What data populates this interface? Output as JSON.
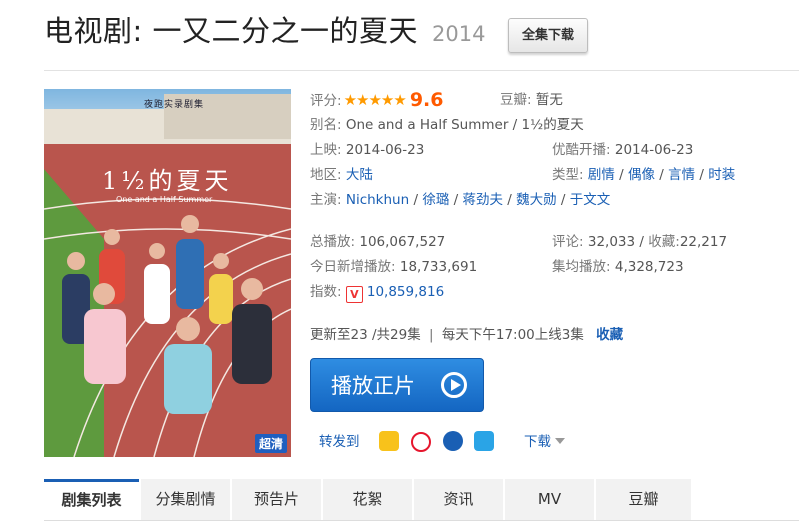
{
  "header": {
    "title": "电视剧: 一又二分之一的夏天",
    "year": "2014",
    "download_all_label": "全集下载"
  },
  "poster": {
    "tagline": "夜跑实录剧集",
    "title_text": "1½的夏天",
    "subtitle_text": "One and a Half Summer",
    "hd_badge": "超清"
  },
  "info": {
    "rating_label": "评分:",
    "rating_stars": "★★★★★",
    "rating_value": "9.6",
    "douban_label": "豆瓣:",
    "douban_value": "暂无",
    "alias_label": "别名:",
    "alias_value": "One and a Half Summer / 1½的夏天",
    "release_label": "上映:",
    "release_value": "2014-06-23",
    "youku_label": "优酷开播:",
    "youku_value": "2014-06-23",
    "region_label": "地区:",
    "region_value": "大陆",
    "genre_label": "类型:",
    "genres": [
      "剧情",
      "偶像",
      "言情",
      "时装"
    ],
    "cast_label": "主演:",
    "cast": [
      "Nichkhun",
      "徐璐",
      "蒋劲夫",
      "魏大勋",
      "于文文"
    ],
    "total_plays_label": "总播放:",
    "total_plays_value": "106,067,527",
    "comments_label": "评论:",
    "comments_value": "32,033",
    "favorites_label": "收藏:",
    "favorites_value": "22,217",
    "today_plays_label": "今日新增播放:",
    "today_plays_value": "18,733,691",
    "avg_plays_label": "集均播放:",
    "avg_plays_value": "4,328,723",
    "index_label": "指数:",
    "index_icon": "V",
    "index_value": "10,859,816",
    "update_status": "更新至23 /共29集",
    "schedule": "每天下午17:00上线3集",
    "favorite_link": "收藏"
  },
  "actions": {
    "play_label": "播放正片",
    "share_label": "转发到",
    "download_label": "下载"
  },
  "tabs": [
    "剧集列表",
    "分集剧情",
    "预告片",
    "花絮",
    "资讯",
    "MV",
    "豆瓣"
  ]
}
